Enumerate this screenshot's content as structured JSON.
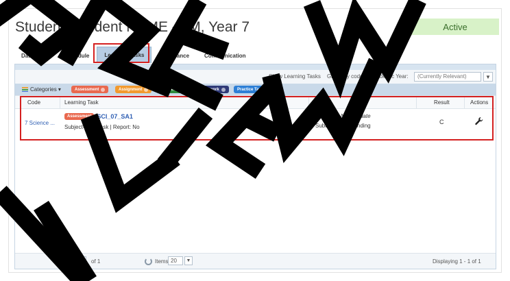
{
  "header": {
    "title": "Student: Student NAME - 7M, Year 7",
    "status": "Active"
  },
  "tabs": [
    {
      "label": "Dashboard"
    },
    {
      "label": "Schedule"
    },
    {
      "label": "Learning Tasks"
    },
    {
      "label": "Attendance"
    },
    {
      "label": "Communication"
    }
  ],
  "toolbar": {
    "show_tasks": "Show Learning Tasks",
    "group_by": "Group by code",
    "year_label": "Academic Year:",
    "year_value": "(Currently Relevant)"
  },
  "categories": {
    "label": "Categories",
    "chips": [
      {
        "label": "Assessment",
        "color": "#e9694f"
      },
      {
        "label": "Assignment",
        "color": "#f29a2e"
      },
      {
        "label": "General",
        "color": "#2e8b3d"
      },
      {
        "label": "Homework",
        "color": "#2f3a78"
      },
      {
        "label": "Practice Task",
        "color": "#2d7fd6"
      }
    ]
  },
  "table": {
    "columns": [
      "Code",
      "Learning Task",
      "Status",
      "Result",
      "Actions"
    ],
    "rows": [
      {
        "code": "7 Science ...",
        "badge": "Assessment",
        "task": "SCI_07_SA1",
        "meta": "Subject-wide Task | Report: No",
        "due_label": "Due date:",
        "due_value": "No due date",
        "submitted_label": "Submitted:",
        "submitted_value": "Pending",
        "result": "C"
      }
    ]
  },
  "pager": {
    "page": "1",
    "of": "of 1",
    "items_label": "Items",
    "items_value": "20",
    "display": "Displaying 1 - 1 of 1"
  },
  "watermark": "PREVIEW"
}
